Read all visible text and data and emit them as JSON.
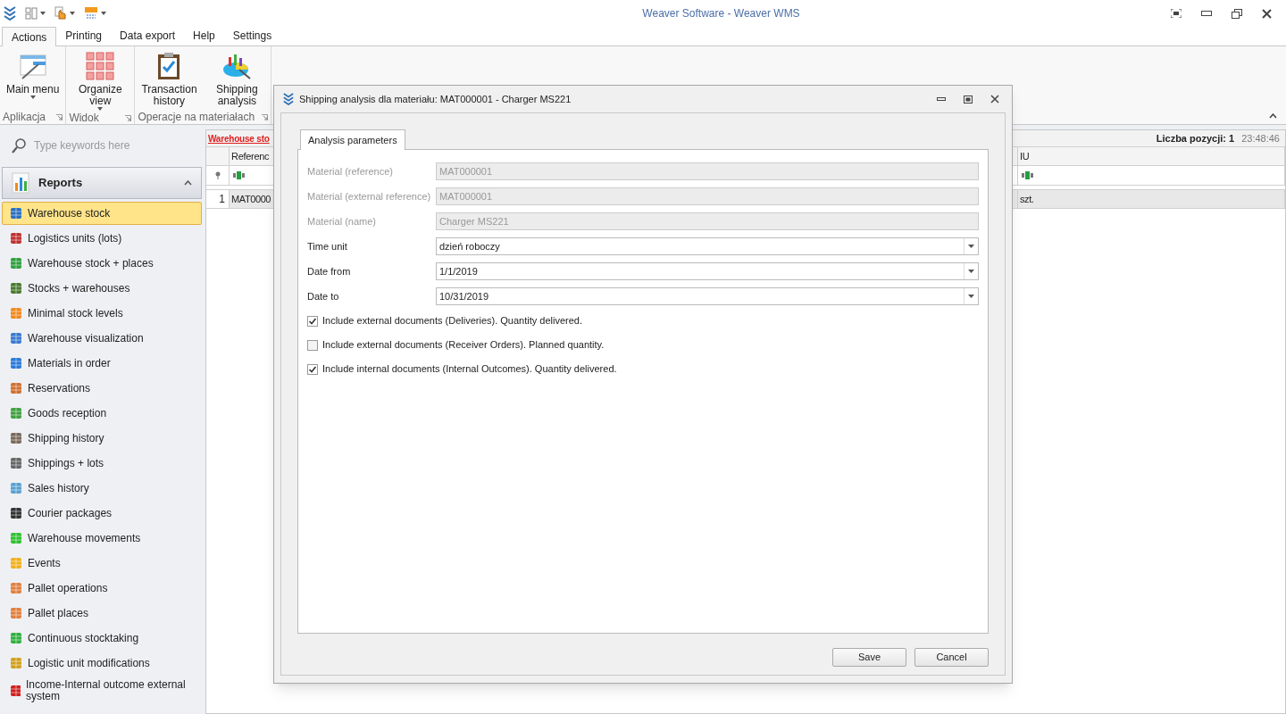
{
  "window": {
    "title": "Weaver Software - Weaver WMS"
  },
  "ribbon": {
    "tabs": [
      {
        "label": "Actions",
        "selected": true
      },
      {
        "label": "Printing",
        "selected": false
      },
      {
        "label": "Data export",
        "selected": false
      },
      {
        "label": "Help",
        "selected": false
      },
      {
        "label": "Settings",
        "selected": false
      }
    ],
    "groups": [
      {
        "label": "Aplikacja",
        "buttons": [
          {
            "label": "Main menu",
            "kind": "menu",
            "dropdown": true
          }
        ]
      },
      {
        "label": "Widok",
        "buttons": [
          {
            "label": "Organize view",
            "kind": "grid",
            "dropdown": true
          }
        ]
      },
      {
        "label": "Operacje na materiałach",
        "buttons": [
          {
            "label": "Transaction history",
            "kind": "clipboard",
            "dropdown": false
          },
          {
            "label": "Shipping analysis",
            "kind": "chart",
            "dropdown": false
          }
        ]
      }
    ]
  },
  "sidebar": {
    "search": {
      "placeholder": "Type keywords here"
    },
    "section": {
      "label": "Reports",
      "expanded": true
    },
    "items": [
      {
        "label": "Warehouse stock",
        "selected": true
      },
      {
        "label": "Logistics units (lots)",
        "selected": false
      },
      {
        "label": "Warehouse stock + places",
        "selected": false
      },
      {
        "label": "Stocks + warehouses",
        "selected": false
      },
      {
        "label": "Minimal stock levels",
        "selected": false
      },
      {
        "label": "Warehouse visualization",
        "selected": false
      },
      {
        "label": "Materials in order",
        "selected": false
      },
      {
        "label": "Reservations",
        "selected": false
      },
      {
        "label": "Goods reception",
        "selected": false
      },
      {
        "label": "Shipping history",
        "selected": false
      },
      {
        "label": "Shippings + lots",
        "selected": false
      },
      {
        "label": "Sales history",
        "selected": false
      },
      {
        "label": "Courier packages",
        "selected": false
      },
      {
        "label": "Warehouse movements",
        "selected": false
      },
      {
        "label": "Events",
        "selected": false
      },
      {
        "label": "Pallet operations",
        "selected": false
      },
      {
        "label": "Pallet places",
        "selected": false
      },
      {
        "label": "Continuous stocktaking",
        "selected": false
      },
      {
        "label": "Logistic unit modifications",
        "selected": false
      },
      {
        "label": "Income-Internal outcome external system",
        "selected": false
      }
    ]
  },
  "grid": {
    "title": "Warehouse sto",
    "count": "Liczba pozycji: 1",
    "time": "23:48:46",
    "columns": [
      "Referenc",
      "IU"
    ],
    "rows": [
      {
        "number": "1",
        "cells": [
          "MAT0000",
          "szt."
        ]
      }
    ]
  },
  "dialog": {
    "title": "Shipping analysis dla materiału: MAT000001 - Charger MS221",
    "tabs": [
      {
        "label": "Analysis parameters",
        "selected": true
      }
    ],
    "fields": [
      {
        "label": "Material (reference)",
        "value": "MAT000001",
        "kind": "text",
        "disabled": true
      },
      {
        "label": "Material (external reference)",
        "value": "MAT000001",
        "kind": "text",
        "disabled": true
      },
      {
        "label": "Material (name)",
        "value": "Charger MS221",
        "kind": "text",
        "disabled": true
      },
      {
        "label": "Time unit",
        "value": "dzień roboczy",
        "kind": "combo",
        "disabled": false
      },
      {
        "label": "Date from",
        "value": "1/1/2019",
        "kind": "combo",
        "disabled": false
      },
      {
        "label": "Date to",
        "value": "10/31/2019",
        "kind": "combo",
        "disabled": false
      }
    ],
    "options": [
      {
        "label": "Include external documents (Deliveries). Quantity delivered.",
        "checked": true
      },
      {
        "label": "Include external documents (Receiver Orders). Planned quantity.",
        "checked": false
      },
      {
        "label": "Include internal documents (Internal Outcomes). Quantity delivered.",
        "checked": true
      }
    ],
    "buttons": [
      "Save",
      "Cancel"
    ]
  }
}
